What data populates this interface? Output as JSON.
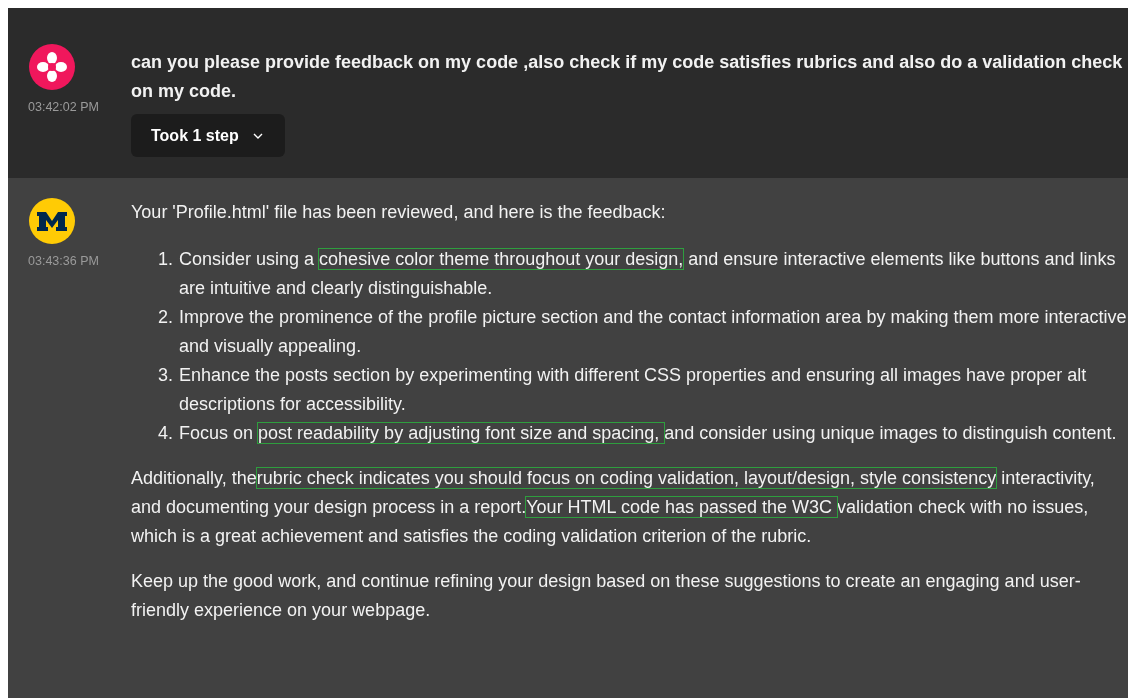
{
  "messages": [
    {
      "kind": "user",
      "time": "03:42:02 PM",
      "text": "can you please provide feedback on my code ,also check if my code satisfies rubrics and also do a validation check on my code.",
      "steps_button": {
        "label": "Took 1 step",
        "expanded": false
      }
    },
    {
      "kind": "assistant",
      "time": "03:43:36 PM",
      "intro": "Your 'Profile.html' file has been reviewed, and here is the feedback:",
      "list": [
        {
          "number": "1.",
          "segments": [
            {
              "text": "Consider using a ",
              "highlighted": false
            },
            {
              "text": "cohesive color theme throughout your design,",
              "highlighted": true
            },
            {
              "text": " and ensure interactive elements like buttons and links are intuitive and clearly distinguishable.",
              "highlighted": false
            }
          ]
        },
        {
          "number": "2.",
          "segments": [
            {
              "text": "Improve the prominence of the profile picture section and the contact information area by making them more interactive and visually appealing.",
              "highlighted": false
            }
          ]
        },
        {
          "number": "3.",
          "segments": [
            {
              "text": "Enhance the posts section by experimenting with different CSS properties and ensuring all images have proper alt descriptions for accessibility.",
              "highlighted": false
            }
          ]
        },
        {
          "number": "4.",
          "segments": [
            {
              "text": "Focus on ",
              "highlighted": false
            },
            {
              "text": "post readability by adjusting font size and spacing, ",
              "highlighted": true
            },
            {
              "text": "and consider using unique images to distinguish content.",
              "highlighted": false
            }
          ]
        }
      ],
      "paragraphs": [
        [
          {
            "text": "Additionally, the",
            "highlighted": false
          },
          {
            "text": "rubric check indicates you should focus on coding validation, layout/design, style consistency",
            "highlighted": true
          },
          {
            "text": " interactivity, and documenting your design process in a report.",
            "highlighted": false
          },
          {
            "text": "Your HTML code has passed the W3C ",
            "highlighted": true
          },
          {
            "text": " validation check with no issues, which is a great achievement and satisfies the coding validation criterion of the rubric.",
            "highlighted": false
          }
        ],
        [
          {
            "text": "Keep up the good work, and continue refining your design based on these suggestions to create an engaging and user-friendly experience on your webpage.",
            "highlighted": false
          }
        ]
      ]
    }
  ]
}
